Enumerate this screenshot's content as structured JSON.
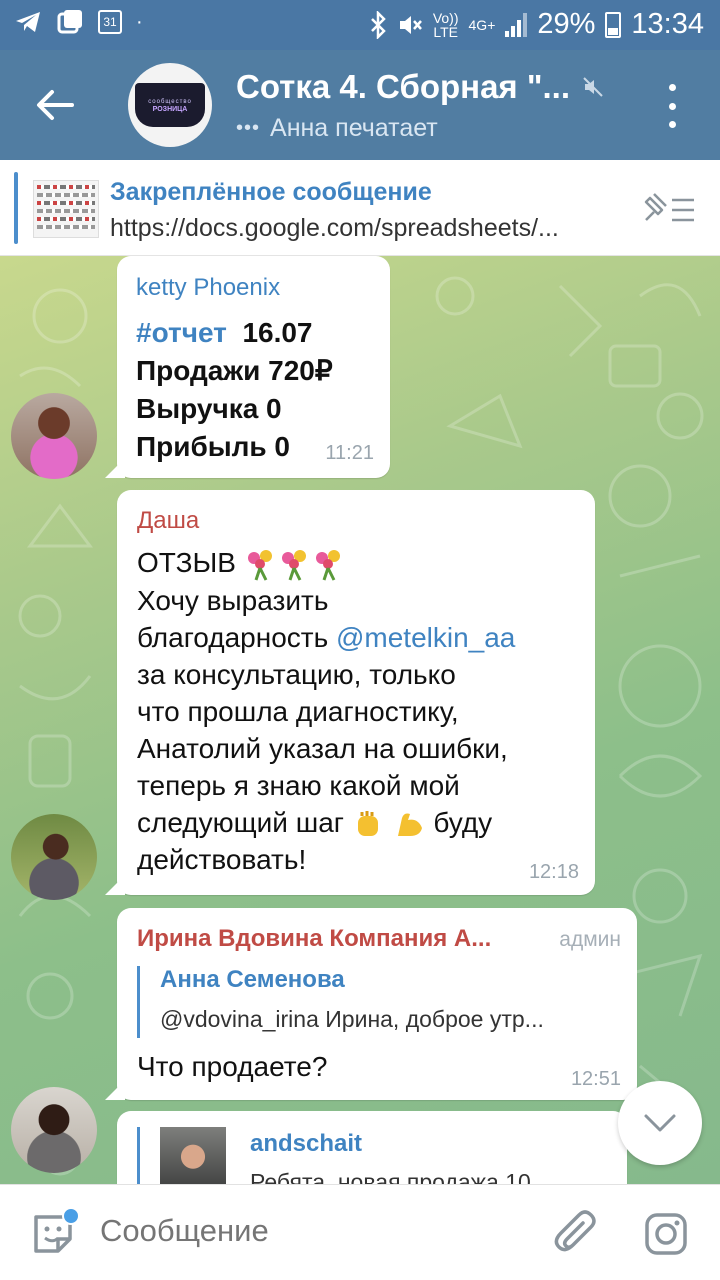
{
  "status_bar": {
    "calendar_day": "31",
    "network_top": "Vo))",
    "network_bottom": "LTE",
    "net_4g": "4G+",
    "battery": "29%",
    "time": "13:34"
  },
  "header": {
    "title": "Сотка 4. Сборная \"...",
    "subtitle": "Анна печатает",
    "avatar_text_top": "сообщество",
    "avatar_text_main": "РОЗНИЦА"
  },
  "pinned": {
    "title": "Закреплённое сообщение",
    "text": "https://docs.google.com/spreadsheets/..."
  },
  "messages": [
    {
      "sender": "ketty Phoenix",
      "hashtag": "#отчет",
      "date": "16.07",
      "line2": "Продажи 720₽",
      "line3": "Выручка 0",
      "line4": "Прибыль 0",
      "time": "11:21"
    },
    {
      "sender": "Даша",
      "lead": "ОТЗЫВ",
      "text_a": "Хочу выразить",
      "text_b": "благодарность",
      "mention": "@metelkin_aa",
      "text_c": "за консультацию, только",
      "text_d": "что прошла диагностику,",
      "text_e": "Анатолий указал на ошибки,",
      "text_f": "теперь я знаю какой мой",
      "text_g": "следующий шаг",
      "text_h": "буду",
      "text_i": "действовать!",
      "time": "12:18"
    },
    {
      "sender": "Ирина Вдовина Компания А...",
      "role": "админ",
      "reply_name": "Анна Семенова",
      "reply_text": "@vdovina_irina Ирина, доброе утр...",
      "text": "Что продаете?",
      "time": "12:51"
    },
    {
      "reply_name": "andschait",
      "reply_text": "Ребята, новая продажа 10..."
    }
  ],
  "input": {
    "placeholder": "Сообщение"
  },
  "colors": {
    "header": "#517da2",
    "status_bar": "#4a77a4",
    "link": "#3f83c1",
    "sender_red": "#c04b45"
  }
}
